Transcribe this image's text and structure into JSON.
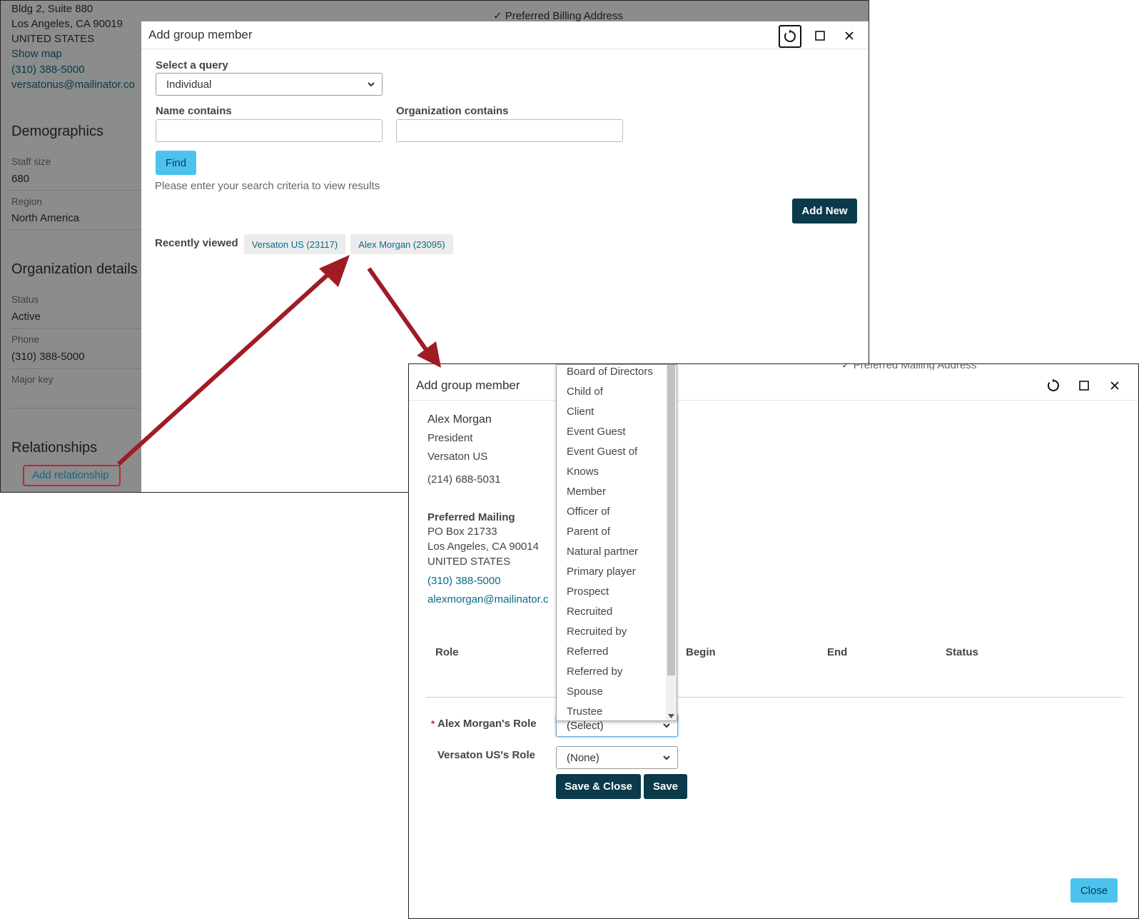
{
  "background_page": {
    "address_line1": "Bldg 2, Suite 880",
    "address_line2": "Los Angeles, CA 90019",
    "address_line3": "UNITED STATES",
    "show_map": "Show map",
    "phone": "(310) 388-5000",
    "email": "versatonus@mailinator.co",
    "preferred_billing": "✓ Preferred Billing Address",
    "preferred_mailing": "✓ Preferred Mailing Address",
    "demographics_heading": "Demographics",
    "staff_size_label": "Staff size",
    "staff_size_value": "680",
    "region_label": "Region",
    "region_value": "North America",
    "org_details_heading": "Organization details",
    "status_label": "Status",
    "status_value": "Active",
    "phone_label": "Phone",
    "phone_value": "(310) 388-5000",
    "major_key_label": "Major key",
    "relationships_heading": "Relationships",
    "add_relationship": "Add relationship"
  },
  "search_dialog": {
    "title": "Add group member",
    "select_query_label": "Select a query",
    "select_query_value": "Individual",
    "name_contains_label": "Name contains",
    "name_contains_value": "",
    "org_contains_label": "Organization contains",
    "org_contains_value": "",
    "find_button": "Find",
    "hint": "Please enter your search criteria to view results",
    "add_new_button": "Add New",
    "recently_viewed_label": "Recently viewed",
    "recent_items": [
      "Versaton US (23117)",
      "Alex Morgan (23095)"
    ]
  },
  "member_dialog": {
    "title": "Add group member",
    "name": "Alex Morgan",
    "job_title": "President",
    "organization": "Versaton US",
    "phone": "(214) 688-5031",
    "preferred_mailing_label": "Preferred Mailing",
    "address_line1": "PO Box 21733",
    "address_line2": "Los Angeles, CA 90014",
    "address_line3": "UNITED STATES",
    "org_phone": "(310) 388-5000",
    "email": "alexmorgan@mailinator.c",
    "table_headers": [
      "Role",
      "Begin",
      "End",
      "Status"
    ],
    "required_marker": "*",
    "member_role_label": "Alex Morgan's Role",
    "member_role_value": "(Select)",
    "org_role_label": "Versaton US's Role",
    "org_role_value": "(None)",
    "save_close_button": "Save & Close",
    "save_button": "Save",
    "close_button": "Close",
    "role_options": [
      "Board of Directors",
      "Child of",
      "Client",
      "Event Guest",
      "Event Guest of",
      "Knows",
      "Member",
      "Officer of",
      "Parent of",
      "Natural partner",
      "Primary player",
      "Prospect",
      "Recruited",
      "Recruited by",
      "Referred",
      "Referred by",
      "Spouse",
      "Trustee"
    ]
  },
  "colors": {
    "accent_dark": "#0b3a4a",
    "accent_light": "#4cc3ef",
    "link": "#0b6a8a",
    "arrow": "#a01b24",
    "highlight_box": "#c0272d"
  },
  "icons": [
    "refresh-icon",
    "maximize-icon",
    "close-icon",
    "chevron-down-icon"
  ]
}
